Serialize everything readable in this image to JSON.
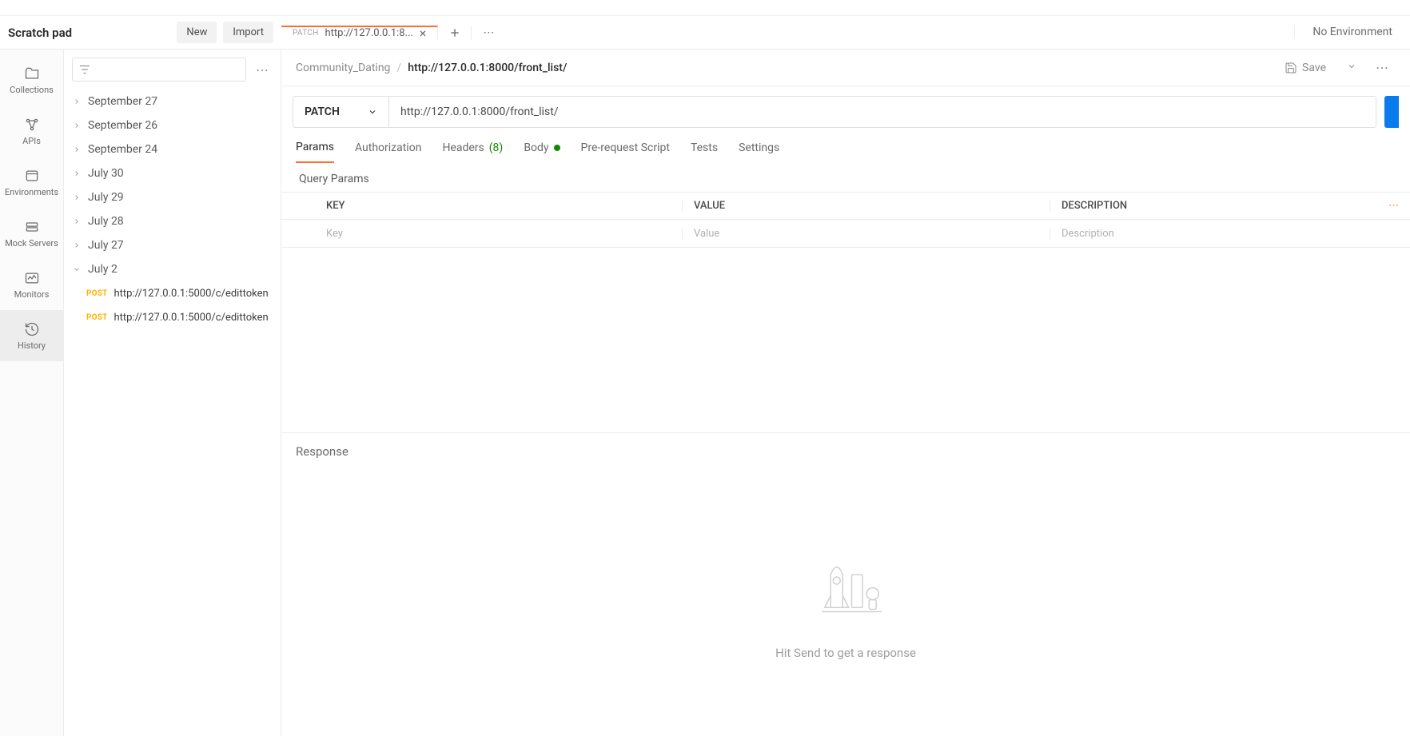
{
  "header": {
    "workspace_title": "Scratch pad",
    "new_button": "New",
    "import_button": "Import",
    "env_selector": "No Environment"
  },
  "tab": {
    "method": "PATCH",
    "label": "http://127.0.0.1:8..."
  },
  "sidebar_rail": {
    "collections": "Collections",
    "apis": "APIs",
    "environments": "Environments",
    "mock_servers": "Mock Servers",
    "monitors": "Monitors",
    "history": "History"
  },
  "history": {
    "groups": [
      {
        "label": "September 27",
        "expanded": false
      },
      {
        "label": "September 26",
        "expanded": false
      },
      {
        "label": "September 24",
        "expanded": false
      },
      {
        "label": "July 30",
        "expanded": false
      },
      {
        "label": "July 29",
        "expanded": false
      },
      {
        "label": "July 28",
        "expanded": false
      },
      {
        "label": "July 27",
        "expanded": false
      },
      {
        "label": "July 2",
        "expanded": true,
        "items": [
          {
            "method": "POST",
            "url": "http://127.0.0.1:5000/c/edittoken"
          },
          {
            "method": "POST",
            "url": "http://127.0.0.1:5000/c/edittoken"
          }
        ]
      }
    ]
  },
  "breadcrumb": {
    "workspace": "Community_Dating",
    "title": "http://127.0.0.1:8000/front_list/",
    "save_label": "Save"
  },
  "request": {
    "method": "PATCH",
    "url": "http://127.0.0.1:8000/front_list/",
    "tabs": {
      "params": "Params",
      "authorization": "Authorization",
      "headers": "Headers",
      "headers_count": "(8)",
      "body": "Body",
      "pre_request": "Pre-request Script",
      "tests": "Tests",
      "settings": "Settings"
    },
    "query_params_label": "Query Params",
    "table": {
      "key_header": "KEY",
      "value_header": "VALUE",
      "desc_header": "DESCRIPTION",
      "key_placeholder": "Key",
      "value_placeholder": "Value",
      "desc_placeholder": "Description"
    }
  },
  "response": {
    "title": "Response",
    "empty_message": "Hit Send to get a response"
  }
}
